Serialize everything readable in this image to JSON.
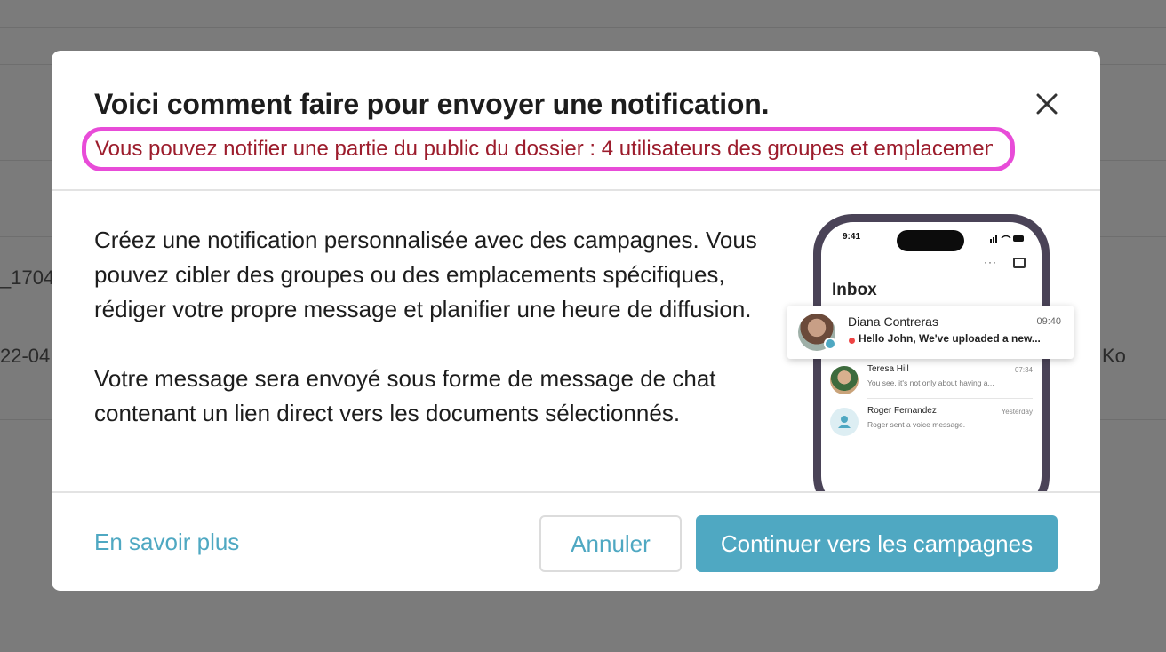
{
  "background": {
    "fragments": [
      "_1704",
      "22-04",
      "Ko"
    ]
  },
  "modal": {
    "title": "Voici comment faire pour envoyer une notification.",
    "subtitle": "Vous pouvez notifier une partie du public du dossier : 4 utilisateurs des groupes et emplacements",
    "body": {
      "paragraph1": "Créez une notification personnalisée avec des campagnes. Vous pouvez cibler des groupes ou des emplacements spécifiques, rédiger votre propre message et planifier une heure de diffusion.",
      "paragraph2": "Votre message sera envoyé sous forme de message de chat contenant un lien direct vers les documents sélectionnés."
    },
    "phone": {
      "status_time": "9:41",
      "toolbar_more": "···",
      "inbox_title": "Inbox",
      "notification": {
        "name": "Diana Contreras",
        "time": "09:40",
        "preview": "Hello John, We've uploaded a new..."
      },
      "messages": [
        {
          "name": "Teresa Hill",
          "time": "07:34",
          "preview": "You see, it's not only about having a..."
        },
        {
          "name": "Roger Fernandez",
          "time": "Yesterday",
          "preview": "Roger sent a voice message."
        }
      ]
    },
    "footer": {
      "learn_more": "En savoir plus",
      "cancel": "Annuler",
      "continue": "Continuer vers les campagnes"
    }
  },
  "colors": {
    "accent": "#4fa8c2",
    "subtitle_text": "#9c1c2c",
    "highlight_border": "#e84cd8",
    "overlay": "#7b7b7b"
  }
}
